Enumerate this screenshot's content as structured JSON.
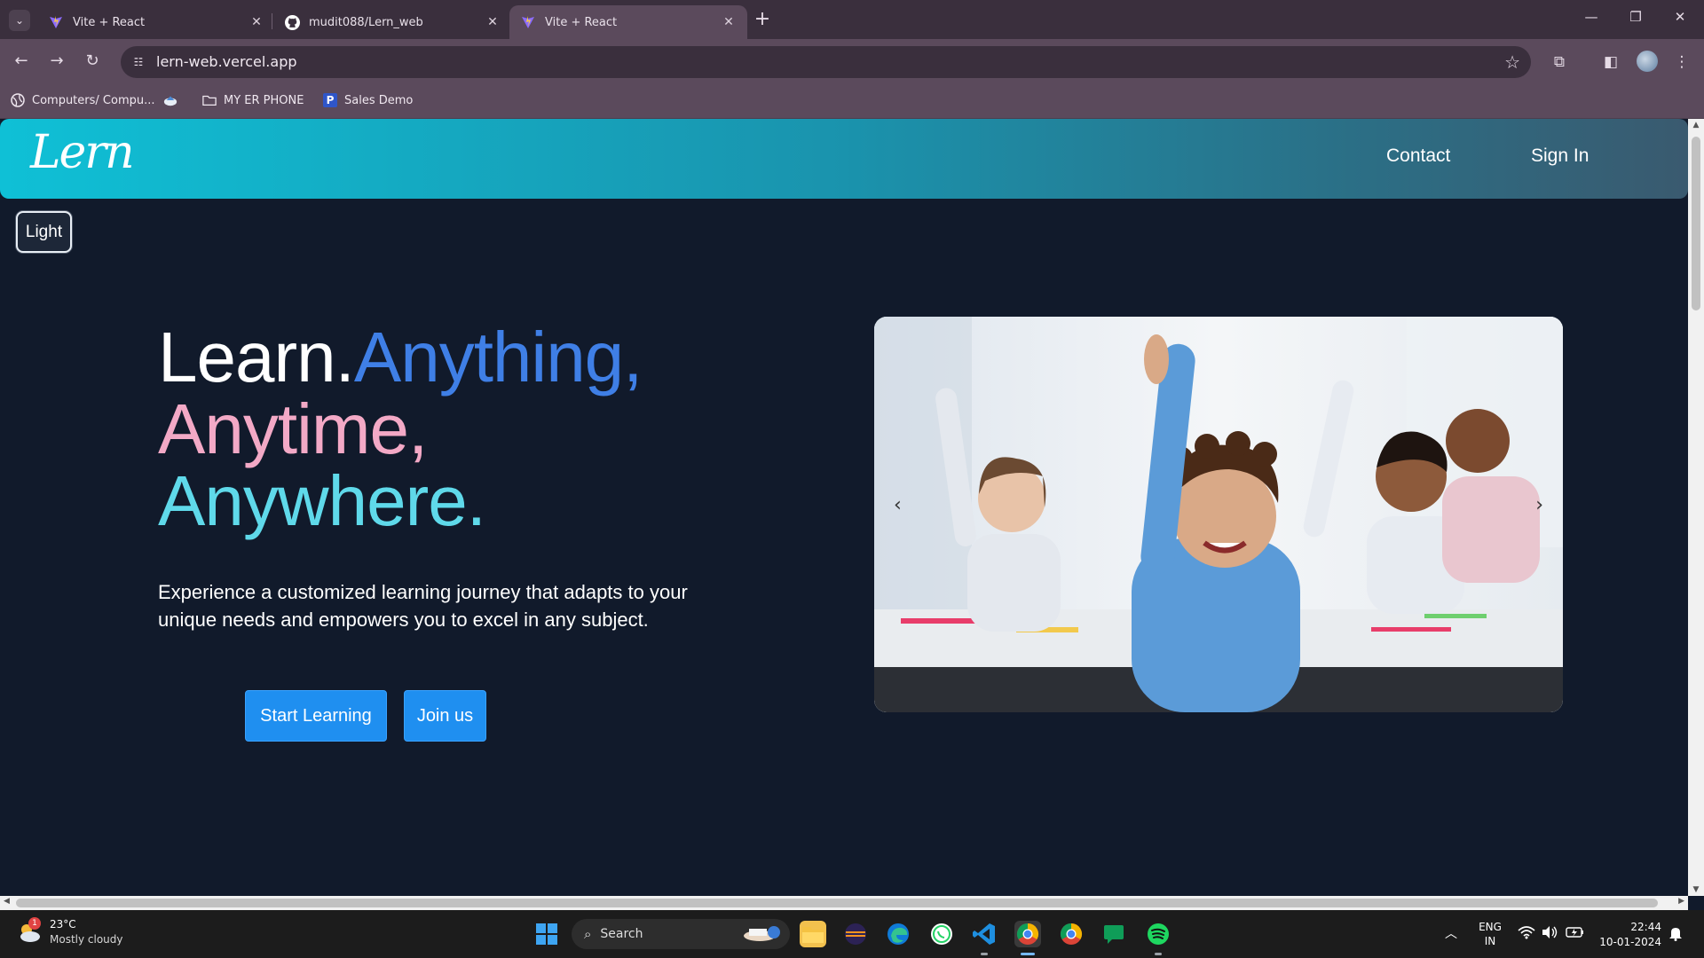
{
  "browser": {
    "tabs": [
      {
        "title": "Vite + React",
        "active": false
      },
      {
        "title": "mudit088/Lern_web",
        "active": false
      },
      {
        "title": "Vite + React",
        "active": true
      }
    ],
    "url": "lern-web.vercel.app",
    "bookmarks": [
      {
        "label": "Computers/ Compu...",
        "icon": "globe-icon"
      },
      {
        "label": "",
        "icon": "app-icon"
      },
      {
        "label": "MY ER PHONE",
        "icon": "folder-icon"
      },
      {
        "label": "Sales Demo",
        "icon": "p-icon"
      }
    ]
  },
  "site": {
    "logo": "Lern",
    "nav": {
      "contact": "Contact",
      "signin": "Sign In"
    },
    "theme_toggle": "Light",
    "hero": {
      "line1_a": "Learn.",
      "line1_b": "Anything,",
      "line2": "Anytime,",
      "line3": "Anywhere.",
      "description": "Experience a customized learning journey that adapts to your unique needs and empowers you to excel in any subject.",
      "btn_start": "Start Learning",
      "btn_join": "Join us"
    },
    "carousel": {
      "prev": "‹",
      "next": "›"
    },
    "colors": {
      "accent_blue": "#3f7fe6",
      "accent_pink": "#f3a9c6",
      "accent_cyan": "#5fd9ea",
      "button": "#1f8ff0",
      "background": "#111a2b"
    }
  },
  "taskbar": {
    "weather": {
      "temp": "23°C",
      "desc": "Mostly cloudy",
      "badge": "1"
    },
    "search_placeholder": "Search",
    "lang": {
      "a": "ENG",
      "b": "IN"
    },
    "time": "22:44",
    "date": "10-01-2024"
  }
}
